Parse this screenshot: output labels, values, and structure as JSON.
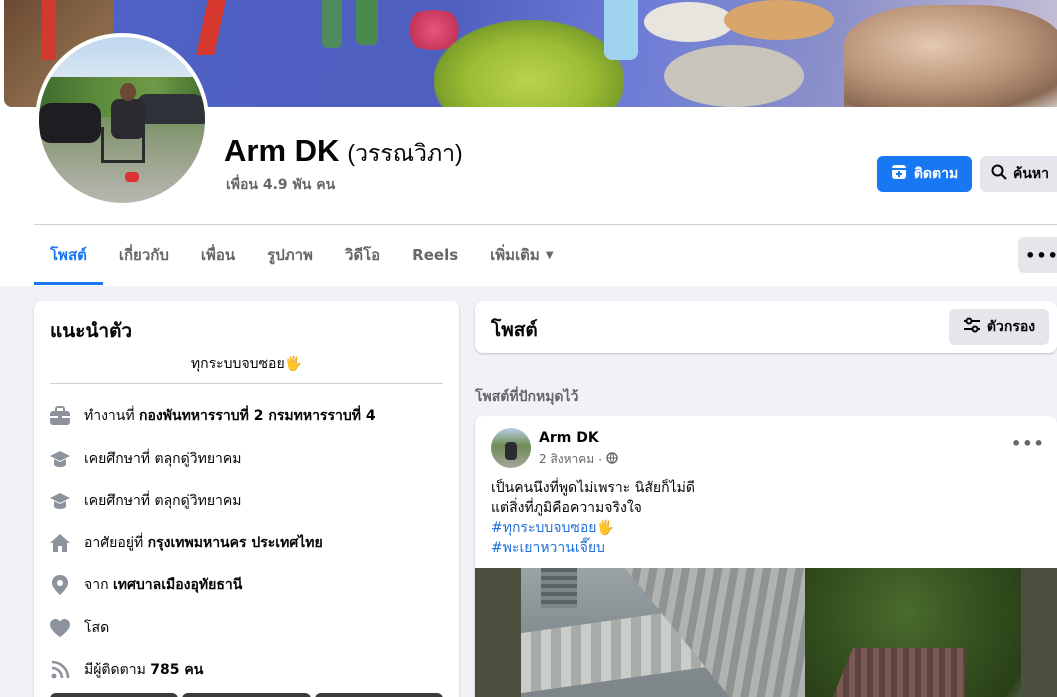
{
  "profile": {
    "name": "Arm DK",
    "alt_name": "(วรรณวิภา)",
    "friends": "เพื่อน 4.9 พัน คน",
    "follow_label": "ติดตาม",
    "search_label": "ค้นหา"
  },
  "tabs": [
    {
      "label": "โพสต์"
    },
    {
      "label": "เกี่ยวกับ"
    },
    {
      "label": "เพื่อน"
    },
    {
      "label": "รูปภาพ"
    },
    {
      "label": "วิดีโอ"
    },
    {
      "label": "Reels"
    },
    {
      "label": "เพิ่มเติม"
    }
  ],
  "intro": {
    "title": "แนะนำตัว",
    "bio": "ทุกระบบจบซอย🖐",
    "items": [
      {
        "icon": "briefcase-icon",
        "prefix": "ทำงานที่ ",
        "value": "กองพันทหารราบที่ 2 กรมทหารราบที่ 4"
      },
      {
        "icon": "graduation-cap-icon",
        "prefix": "เคยศึกษาที่ ",
        "value": "ตลุกดู่วิทยาคม"
      },
      {
        "icon": "graduation-cap-icon",
        "prefix": "เคยศึกษาที่ ",
        "value": "ตลุกดู่วิทยาคม"
      },
      {
        "icon": "home-icon",
        "prefix": "อาศัยอยู่ที่ ",
        "value": "กรุงเทพมหานคร ประเทศไทย"
      },
      {
        "icon": "location-pin-icon",
        "prefix": "จาก ",
        "value": "เทศบาลเมืองอุทัยธานี"
      },
      {
        "icon": "heart-icon",
        "prefix": "โสด",
        "value": ""
      },
      {
        "icon": "rss-icon",
        "prefix": "มีผู้ติดตาม ",
        "value": "785 คน"
      }
    ]
  },
  "posts": {
    "title": "โพสต์",
    "filter_label": "ตัวกรอง",
    "pinned_label": "โพสต์ที่ปักหมุดไว้"
  },
  "post": {
    "author": "Arm DK",
    "date": "2 สิงหาคม",
    "lines": [
      "เป็นคนนึงที่พูดไม่เพราะ นิสัยก็ไม่ดี",
      "แต่สิ่งที่ภูมิคือความจริงใจ"
    ],
    "hashtags": [
      "#ทุกระบบจบซอย🖐",
      "#พะเยาหวานเจี๊ยบ"
    ]
  },
  "colors": {
    "accent": "#1877f2",
    "hashtag": "#216fdb",
    "secondary_text": "#65676b"
  }
}
